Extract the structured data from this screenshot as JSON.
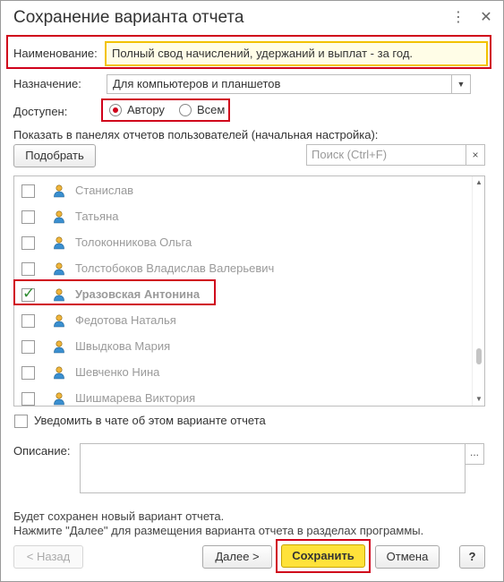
{
  "window": {
    "title": "Сохранение варианта отчета",
    "more_icon": "⋮",
    "close_icon": "✕"
  },
  "form": {
    "name_label": "Наименование:",
    "name_value": "Полный свод начислений, удержаний и выплат - за год.",
    "purpose_label": "Назначение:",
    "purpose_value": "Для компьютеров и планшетов",
    "available_label": "Доступен:",
    "available_options": [
      "Автору",
      "Всем"
    ],
    "available_selected": "Автору",
    "panels_label": "Показать в панелях отчетов пользователей (начальная настройка):",
    "pick_button": "Подобрать",
    "search_placeholder": "Поиск (Ctrl+F)",
    "clear_icon": "×"
  },
  "users": [
    {
      "name": "Станислав",
      "checked": false
    },
    {
      "name": "Татьяна",
      "checked": false
    },
    {
      "name": "Толоконникова Ольга",
      "checked": false
    },
    {
      "name": "Толстобоков Владислав Валерьевич",
      "checked": false
    },
    {
      "name": "Уразовская Антонина",
      "checked": true
    },
    {
      "name": "Федотова Наталья",
      "checked": false
    },
    {
      "name": "Швыдкова Мария",
      "checked": false
    },
    {
      "name": "Шевченко Нина",
      "checked": false
    },
    {
      "name": "Шишмарева Виктория",
      "checked": false
    }
  ],
  "notify": {
    "label": "Уведомить в чате об этом варианте отчета",
    "checked": false
  },
  "description": {
    "label": "Описание:",
    "more_icon": "..."
  },
  "info": {
    "line1": "Будет сохранен новый вариант отчета.",
    "line2": "Нажмите \"Далее\" для размещения варианта отчета в разделах программы."
  },
  "buttons": {
    "back": "< Назад",
    "next": "Далее >",
    "save": "Сохранить",
    "cancel": "Отмена",
    "help": "?"
  },
  "colors": {
    "highlight": "#d0021b",
    "primary": "#ffe23a",
    "check": "#2e8b30"
  }
}
